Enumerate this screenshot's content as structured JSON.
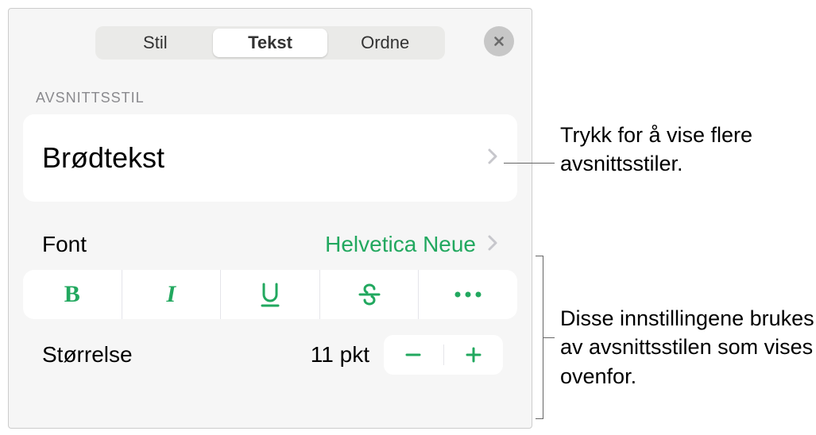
{
  "tabs": {
    "stil": "Stil",
    "tekst": "Tekst",
    "ordne": "Ordne"
  },
  "section": {
    "paragraph_label": "AVSNITTSSTIL",
    "style_name": "Brødtekst"
  },
  "font": {
    "label": "Font",
    "value": "Helvetica Neue"
  },
  "size": {
    "label": "Størrelse",
    "value": "11 pkt"
  },
  "callouts": {
    "c1": "Trykk for å vise flere avsnittsstiler.",
    "c2": "Disse innstillingene brukes av avsnittsstilen som vises ovenfor."
  }
}
